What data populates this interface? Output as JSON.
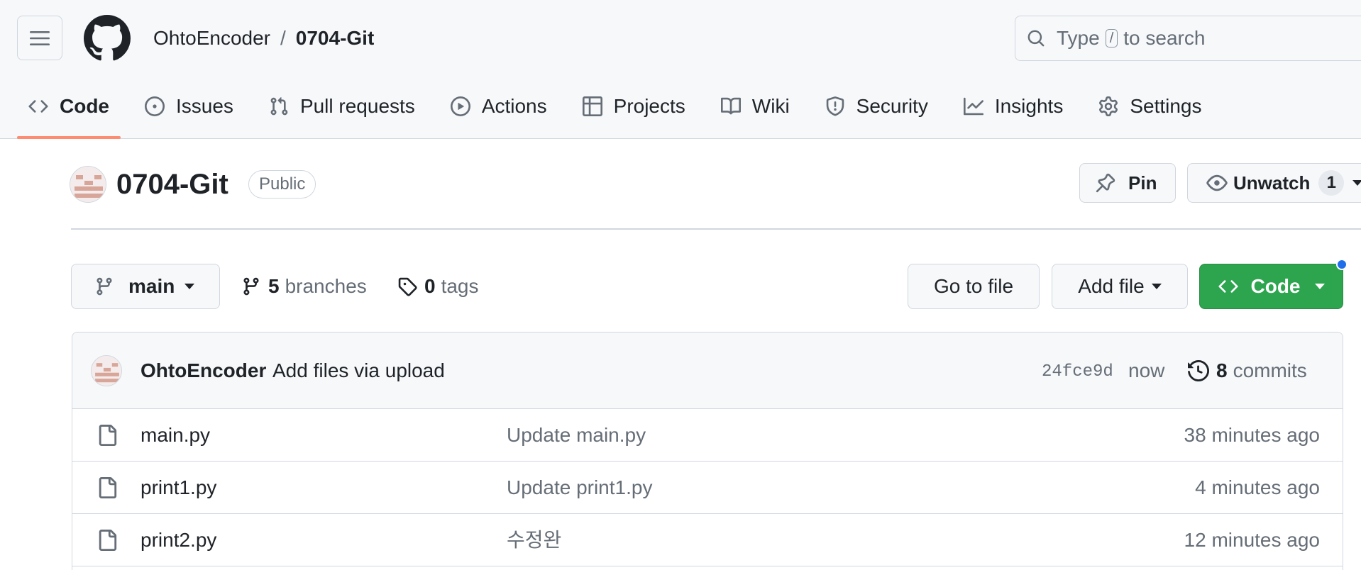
{
  "header": {
    "owner": "OhtoEncoder",
    "separator": "/",
    "repo": "0704-Git",
    "search": {
      "before": "Type",
      "key": "/",
      "after": "to search"
    }
  },
  "tabs": [
    {
      "label": "Code",
      "icon": "code-icon",
      "active": true
    },
    {
      "label": "Issues",
      "icon": "issue-opened-icon",
      "active": false
    },
    {
      "label": "Pull requests",
      "icon": "git-pull-request-icon",
      "active": false
    },
    {
      "label": "Actions",
      "icon": "play-icon",
      "active": false
    },
    {
      "label": "Projects",
      "icon": "table-icon",
      "active": false
    },
    {
      "label": "Wiki",
      "icon": "book-icon",
      "active": false
    },
    {
      "label": "Security",
      "icon": "shield-icon",
      "active": false
    },
    {
      "label": "Insights",
      "icon": "graph-icon",
      "active": false
    },
    {
      "label": "Settings",
      "icon": "gear-icon",
      "active": false
    }
  ],
  "repo": {
    "name": "0704-Git",
    "visibility": "Public",
    "pin_label": "Pin",
    "watch_label": "Unwatch",
    "watch_count": "1"
  },
  "branch_bar": {
    "branch": "main",
    "branches_count": "5",
    "branches_label": "branches",
    "tags_count": "0",
    "tags_label": "tags",
    "go_to_file": "Go to file",
    "add_file": "Add file",
    "code": "Code"
  },
  "latest_commit": {
    "author": "OhtoEncoder",
    "message": "Add files via upload",
    "sha": "24fce9d",
    "time": "now",
    "commits_count": "8",
    "commits_label": "commits"
  },
  "files": [
    {
      "name": "main.py",
      "message": "Update main.py",
      "time": "38 minutes ago"
    },
    {
      "name": "print1.py",
      "message": "Update print1.py",
      "time": "4 minutes ago"
    },
    {
      "name": "print2.py",
      "message": "수정완",
      "time": "12 minutes ago"
    }
  ],
  "colors": {
    "accent_underline": "#fd8c73",
    "code_button": "#2da44e",
    "notification_dot": "#1f6feb",
    "muted_text": "#656d76",
    "border": "#d0d7de"
  }
}
